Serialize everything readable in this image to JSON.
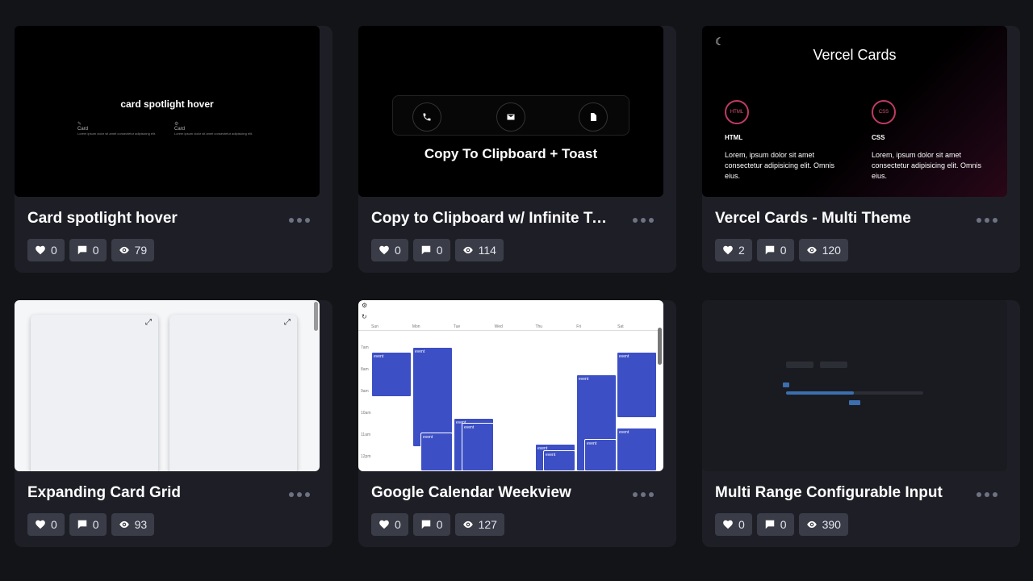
{
  "cards": [
    {
      "title": "Card spotlight hover",
      "likes": "0",
      "comments": "0",
      "views": "79",
      "preview": {
        "heading": "card spotlight hover",
        "items": [
          {
            "label": "Card",
            "text": "Lorem ipsum dolor sit amet consectetur adipisicing elit."
          },
          {
            "label": "Card",
            "text": "Lorem ipsum dolor sit amet consectetur adipisicing elit."
          }
        ]
      }
    },
    {
      "title": "Copy to Clipboard w/ Infinite To...",
      "likes": "0",
      "comments": "0",
      "views": "114",
      "preview": {
        "heading": "Copy To Clipboard + Toast"
      }
    },
    {
      "title": "Vercel Cards - Multi Theme",
      "likes": "2",
      "comments": "0",
      "views": "120",
      "preview": {
        "heading": "Vercel Cards",
        "items": [
          {
            "badge": "HTML",
            "label": "HTML",
            "text": "Lorem, ipsum dolor sit amet consectetur adipisicing elit. Omnis eius."
          },
          {
            "badge": "CSS",
            "label": "CSS",
            "text": "Lorem, ipsum dolor sit amet consectetur adipisicing elit. Omnis eius."
          }
        ]
      }
    },
    {
      "title": "Expanding Card Grid",
      "likes": "0",
      "comments": "0",
      "views": "93",
      "preview": {}
    },
    {
      "title": "Google Calendar Weekview",
      "likes": "0",
      "comments": "0",
      "views": "127",
      "preview": {
        "days": [
          "Sun",
          "Mon",
          "Tue",
          "Wed",
          "Thu",
          "Fri",
          "Sat"
        ],
        "times": [
          "7am",
          "8am",
          "9am",
          "10am",
          "11am",
          "12pm"
        ],
        "event_label": "event"
      }
    },
    {
      "title": "Multi Range Configurable Input",
      "likes": "0",
      "comments": "0",
      "views": "390",
      "preview": {}
    }
  ],
  "colors": {
    "accent_blue": "#3c4fc4",
    "badge_pink": "#c03b63",
    "card_bg": "#1e1f26",
    "page_bg": "#131417"
  }
}
